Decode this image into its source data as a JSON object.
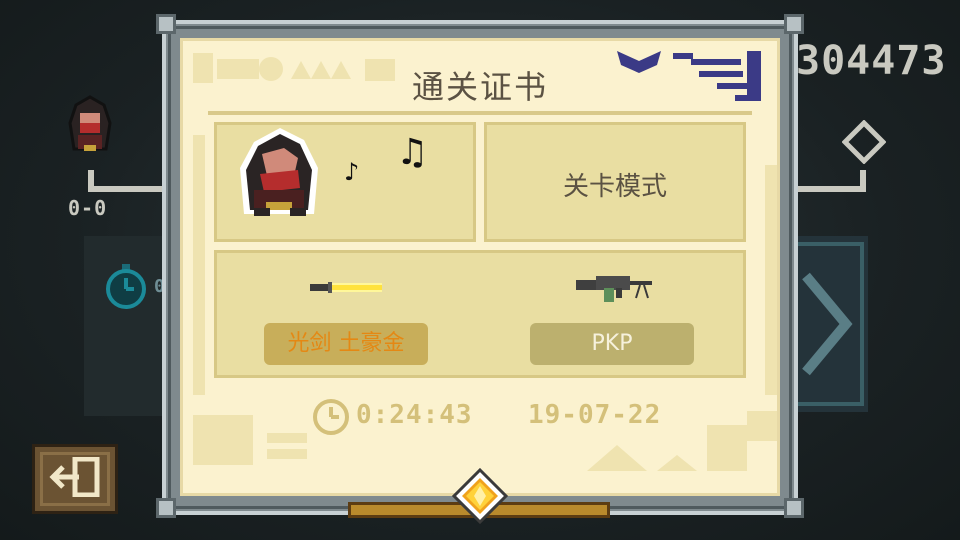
{
  "background": {
    "score_left": "0-0",
    "time_left": "0",
    "counter": "304473"
  },
  "certificate": {
    "title": "通关证书",
    "mode": "关卡模式",
    "weapons": [
      {
        "name": "光剑 土豪金",
        "icon": "lightsaber-icon"
      },
      {
        "name": "PKP",
        "icon": "machine-gun-icon"
      }
    ],
    "time": "0:24:43",
    "date": "19-07-22"
  },
  "colors": {
    "card": "#fbf2cf",
    "panel": "#e9dea2",
    "weapon_gold": "#e48814",
    "frame": "#7f8a8e"
  }
}
